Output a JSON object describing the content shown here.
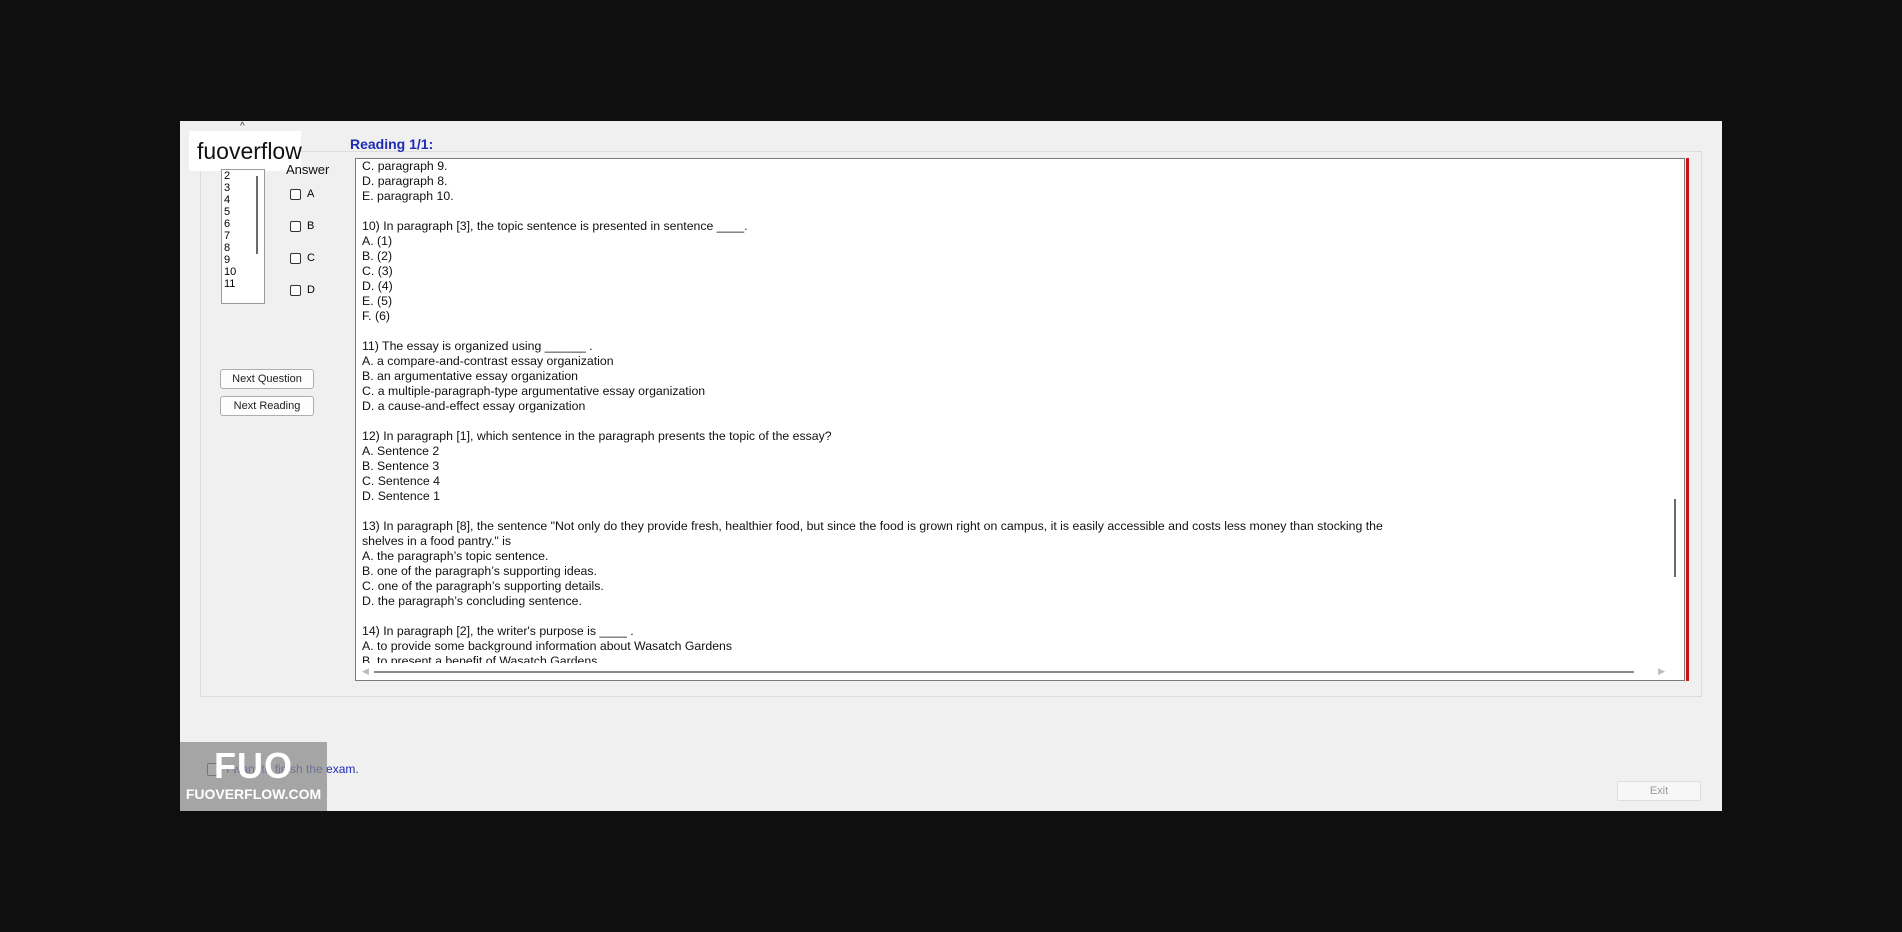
{
  "header": {
    "reading_title": "Reading 1/1:",
    "watermark_text": "fuoverflow"
  },
  "sidebar": {
    "question_numbers": [
      "2",
      "3",
      "4",
      "5",
      "6",
      "7",
      "8",
      "9",
      "10",
      "11"
    ],
    "answer_label": "Answer",
    "options": [
      "A",
      "B",
      "C",
      "D"
    ],
    "next_question_label": "Next Question",
    "next_reading_label": "Next Reading"
  },
  "reading": {
    "lines": [
      "C.  paragraph 9.",
      "D.  paragraph 8.",
      "E.  paragraph 10.",
      "",
      "10) In paragraph [3], the topic sentence is presented in sentence ____.",
      "A.  (1)",
      "B.  (2)",
      "C.  (3)",
      "D.  (4)",
      "E.  (5)",
      "F.  (6)",
      "",
      "11) The essay is organized using ______ .",
      "A.   a compare-and-contrast essay organization",
      "B.  an argumentative essay organization",
      "C.   a multiple-paragraph-type argumentative essay organization",
      "D.  a cause-and-effect essay organization",
      "",
      "12) In paragraph [1], which sentence in the paragraph presents the topic of the essay?",
      "A.  Sentence 2",
      "B.  Sentence 3",
      "C.  Sentence 4",
      "D.  Sentence 1",
      "",
      "13) In paragraph [8], the sentence \"Not only do they provide fresh, healthier food, but since the food is grown right on campus, it is easily accessible and costs less money than stocking the",
      "shelves in a food pantry.\" is",
      "A.  the paragraph’s topic sentence.",
      "B.   one of the paragraph’s supporting ideas.",
      "C.   one of the paragraph’s supporting details.",
      "D.   the paragraph’s concluding sentence.",
      "",
      "14) In paragraph [2], the writer's purpose is ____ .",
      "A.   to provide some background information about Wasatch Gardens",
      "B.   to present a benefit of Wasatch Gardens"
    ]
  },
  "footer": {
    "finish_label": "I want to finish the exam.",
    "exit_label": "Exit",
    "badge_logo": "FUO",
    "badge_url": "FUOVERFLOW.COM"
  }
}
